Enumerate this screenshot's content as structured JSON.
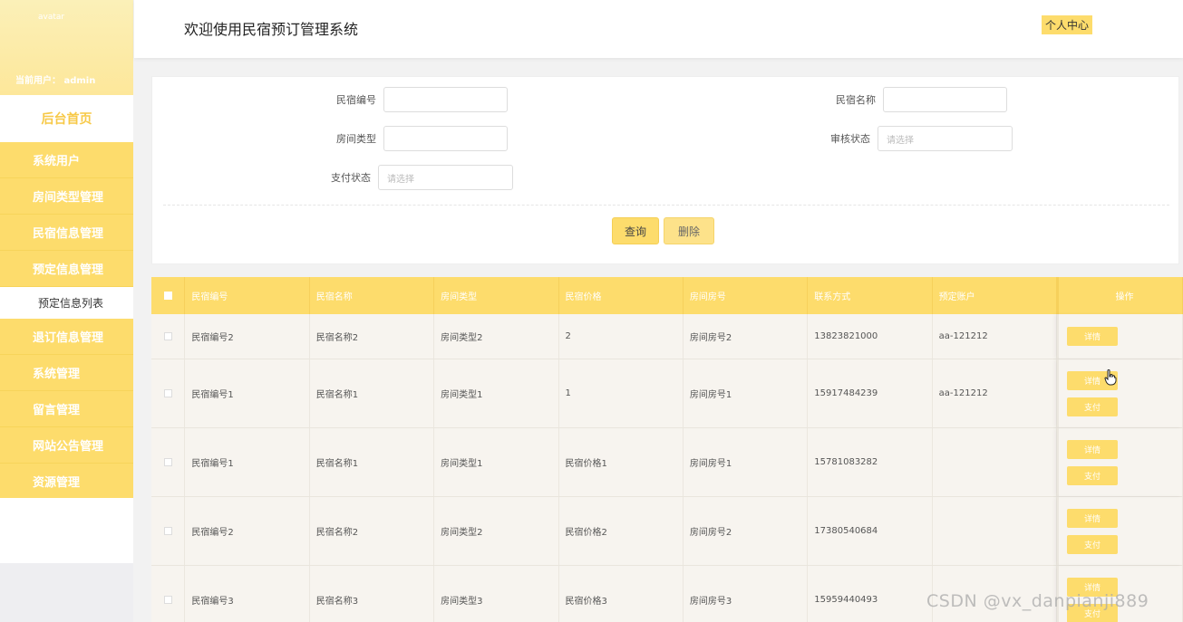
{
  "sidebar": {
    "avatar_text": "avatar",
    "current_user": "当前用户：  admin",
    "home": "后台首页",
    "items": [
      {
        "label": "系统用户"
      },
      {
        "label": "房间类型管理"
      },
      {
        "label": "民宿信息管理"
      },
      {
        "label": "预定信息管理",
        "expanded": true,
        "children": [
          "预定信息列表"
        ]
      },
      {
        "label": "退订信息管理"
      },
      {
        "label": "系统管理"
      },
      {
        "label": "留言管理"
      },
      {
        "label": "网站公告管理"
      },
      {
        "label": "资源管理"
      }
    ]
  },
  "header": {
    "title": "欢迎使用民宿预订管理系统",
    "profile_button": "个人中心"
  },
  "search": {
    "fields": {
      "homestay_no": {
        "label": "民宿编号",
        "value": ""
      },
      "homestay_name": {
        "label": "民宿名称",
        "value": ""
      },
      "room_type": {
        "label": "房间类型",
        "value": ""
      },
      "audit_status": {
        "label": "审核状态",
        "placeholder": "请选择"
      },
      "pay_status": {
        "label": "支付状态",
        "placeholder": "请选择"
      }
    },
    "query_button": "查询",
    "delete_button": "删除"
  },
  "table": {
    "columns": [
      "民宿编号",
      "民宿名称",
      "房间类型",
      "民宿价格",
      "房间房号",
      "联系方式",
      "预定账户",
      "操作"
    ],
    "detail_label": "详情",
    "pay_label": "支付",
    "rows": [
      {
        "no": "民宿编号2",
        "name": "民宿名称2",
        "type": "房间类型2",
        "price": "2",
        "room": "房间房号2",
        "phone": "13823821000",
        "account": "aa-121212",
        "has_pay": false
      },
      {
        "no": "民宿编号1",
        "name": "民宿名称1",
        "type": "房间类型1",
        "price": "1",
        "room": "房间房号1",
        "phone": "15917484239",
        "account": "aa-121212",
        "has_pay": true
      },
      {
        "no": "民宿编号1",
        "name": "民宿名称1",
        "type": "房间类型1",
        "price": "民宿价格1",
        "room": "房间房号1",
        "phone": "15781083282",
        "account": "",
        "has_pay": true
      },
      {
        "no": "民宿编号2",
        "name": "民宿名称2",
        "type": "房间类型2",
        "price": "民宿价格2",
        "room": "房间房号2",
        "phone": "17380540684",
        "account": "",
        "has_pay": true
      },
      {
        "no": "民宿编号3",
        "name": "民宿名称3",
        "type": "房间类型3",
        "price": "民宿价格3",
        "room": "房间房号3",
        "phone": "15959440493",
        "account": "",
        "has_pay": true
      }
    ]
  },
  "watermark": "CSDN @vx_danpianji889",
  "colors": {
    "accent": "#fddc6c",
    "row_bg": "#f7f4ef",
    "header_title": "#222222"
  }
}
